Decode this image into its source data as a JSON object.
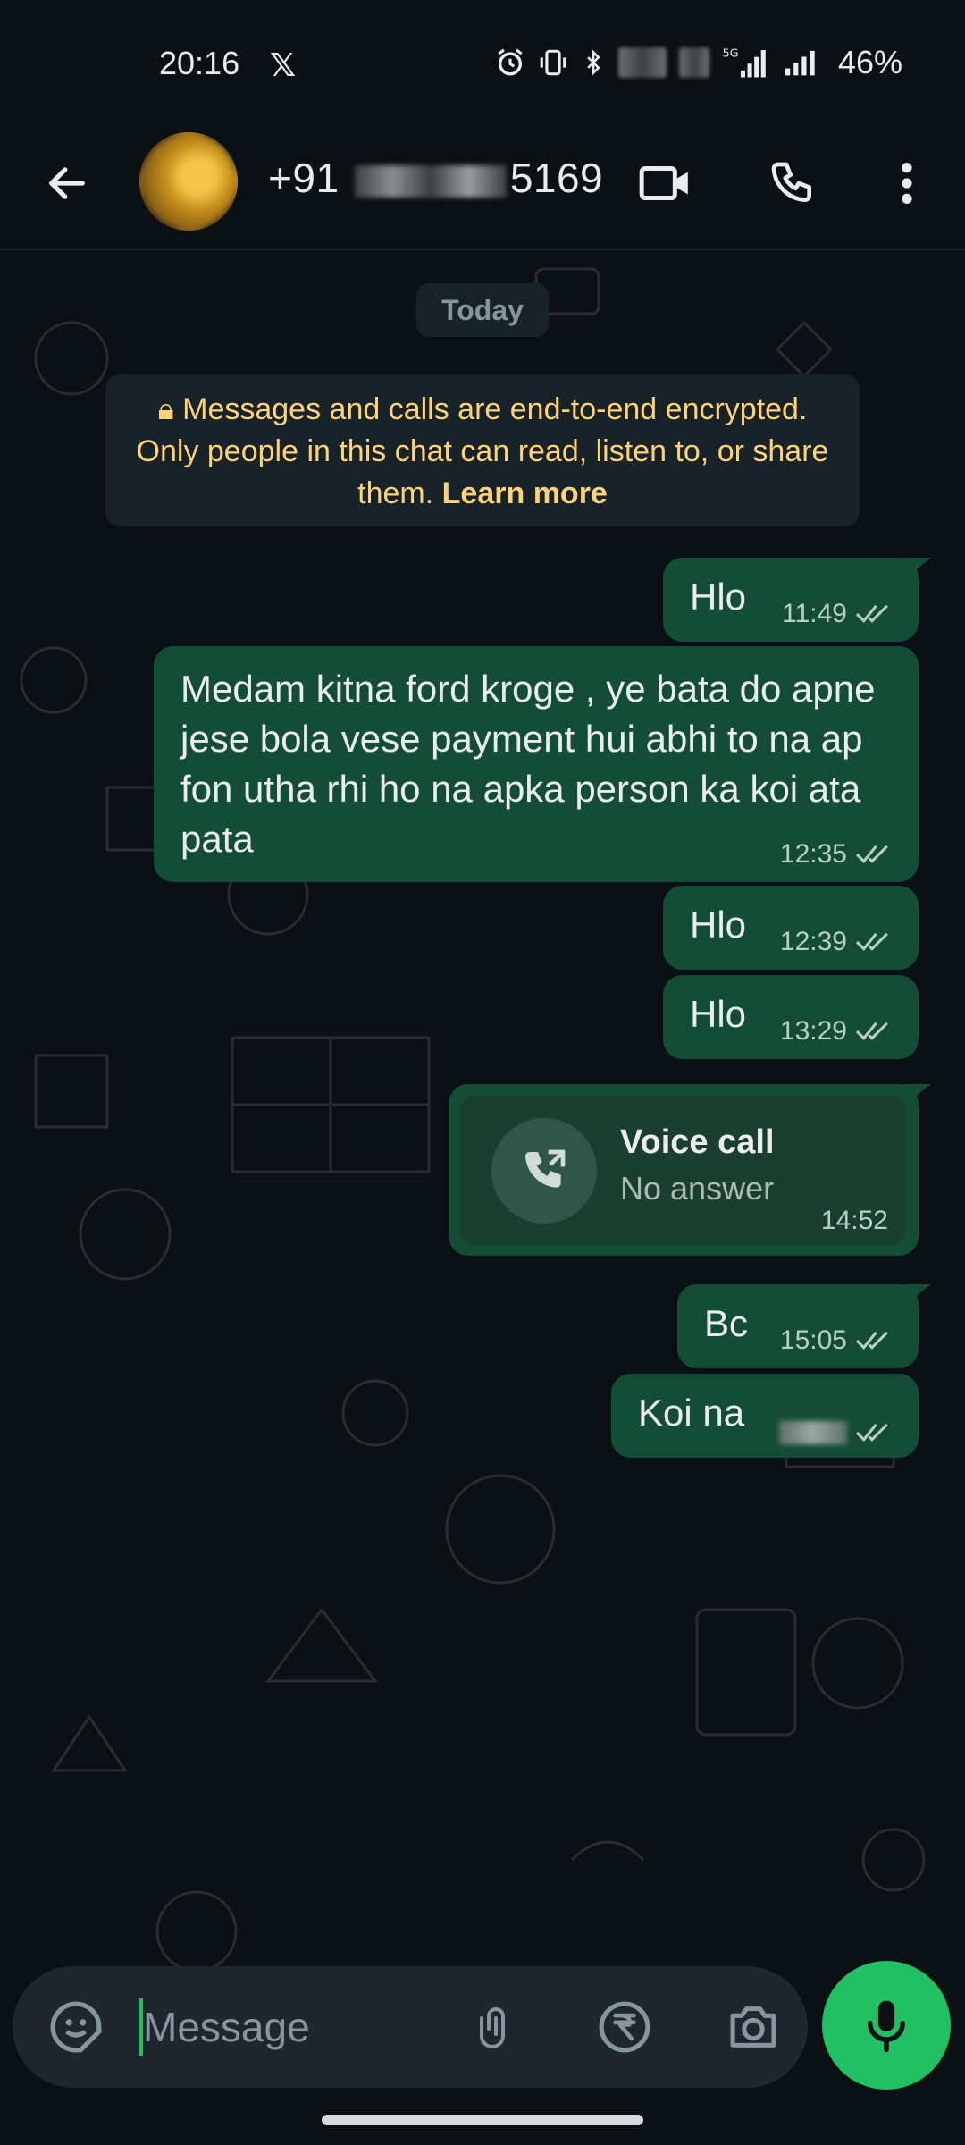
{
  "status_bar": {
    "time": "20:16",
    "battery": "46%",
    "network": "5G"
  },
  "header": {
    "contact_prefix": "+91",
    "contact_suffix": "5169"
  },
  "chat": {
    "date_chip": "Today",
    "encryption_notice": "Messages and calls are end-to-end encrypted. Only people in this chat can read, listen to, or share them.",
    "learn_more": "Learn more",
    "messages": [
      {
        "text": "Hlo",
        "time": "11:49",
        "status": "read"
      },
      {
        "text": "Medam kitna ford kroge ,  ye bata do apne jese bola vese payment hui abhi to na ap fon utha rhi ho na apka person ka koi ata pata",
        "time": "12:35",
        "status": "read"
      },
      {
        "text": "Hlo",
        "time": "12:39",
        "status": "read"
      },
      {
        "text": "Hlo",
        "time": "13:29",
        "status": "read"
      },
      {
        "type": "call",
        "title": "Voice call",
        "subtitle": "No answer",
        "time": "14:52"
      },
      {
        "text": "Bc",
        "time": "15:05",
        "status": "read"
      },
      {
        "text": "Koi na",
        "time": "",
        "status": "read"
      }
    ]
  },
  "input": {
    "placeholder": "Message"
  },
  "colors": {
    "background": "#0b1014",
    "outgoing_bubble": "#144d37",
    "accent_green": "#21c063",
    "notice_text": "#ffd279"
  }
}
